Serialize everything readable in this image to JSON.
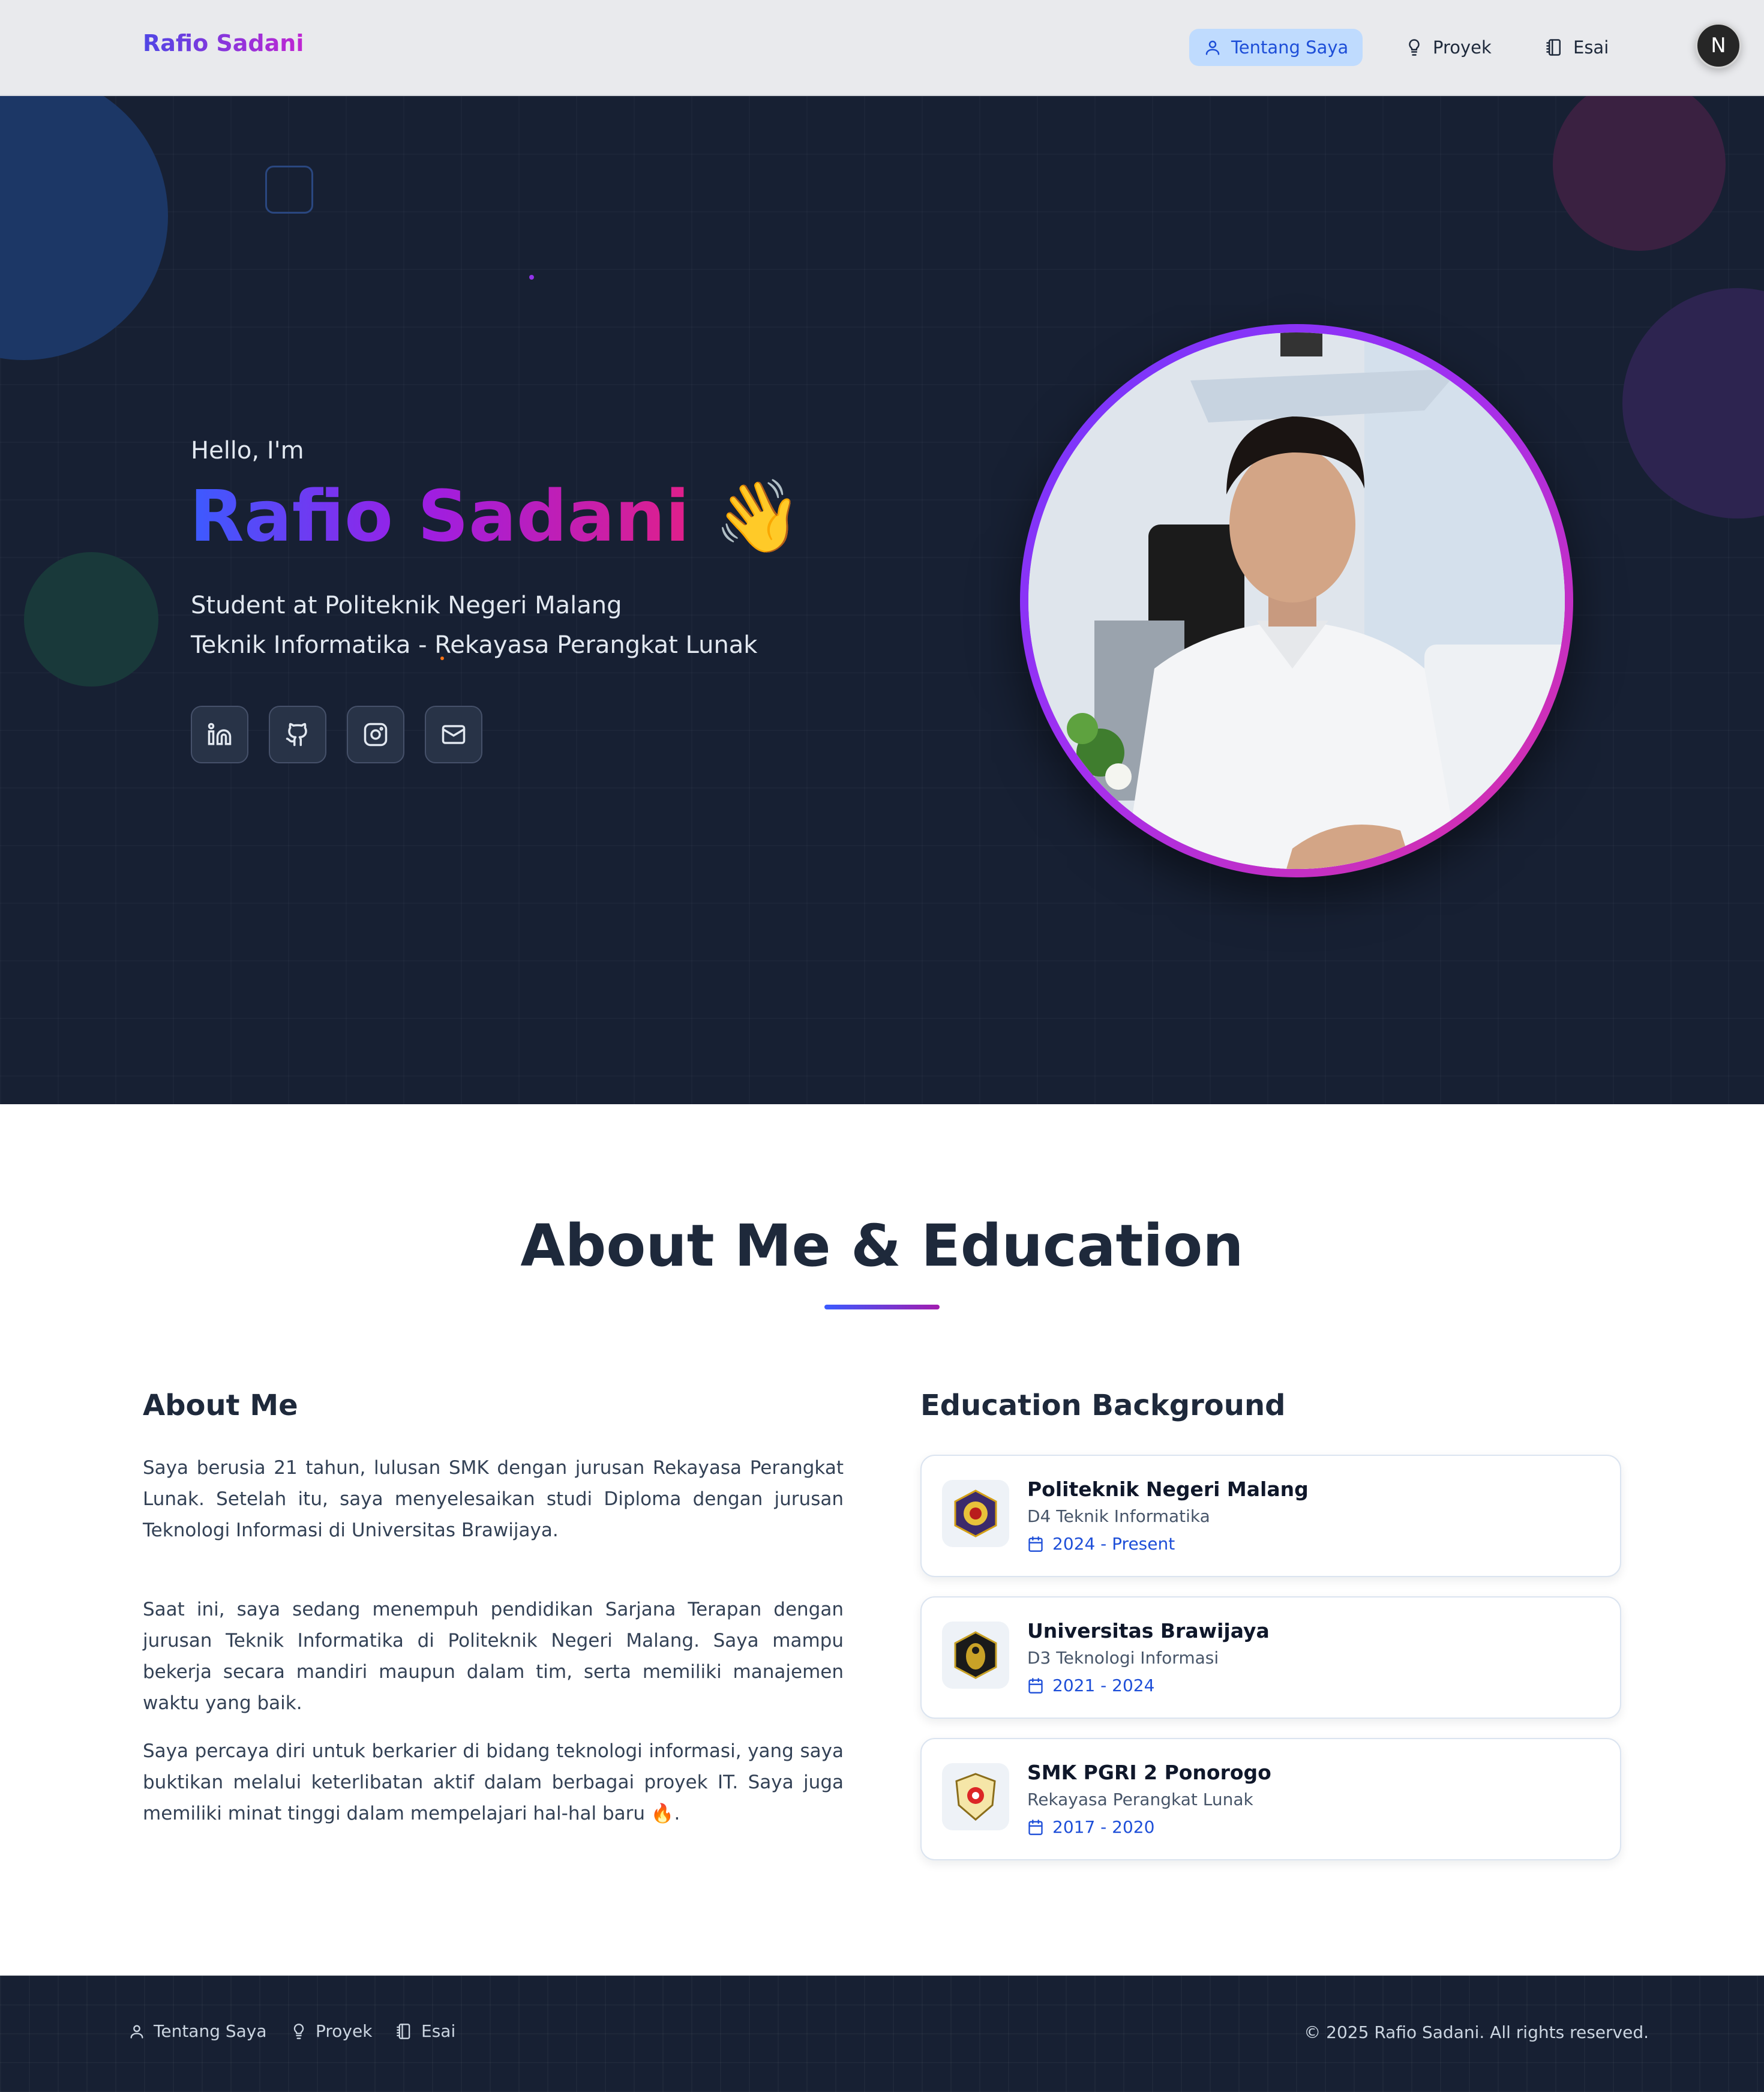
{
  "brand": "Rafio Sadani",
  "nav": {
    "items": [
      {
        "label": "Tentang Saya",
        "icon": "user-icon",
        "active": true
      },
      {
        "label": "Proyek",
        "icon": "lightbulb-icon",
        "active": false
      },
      {
        "label": "Esai",
        "icon": "notebook-icon",
        "active": false
      }
    ],
    "theme_toggle": "N"
  },
  "hero": {
    "greeting": "Hello, I'm",
    "name": "Rafio Sadani",
    "emoji": "👋",
    "subtitle_line1": "Student at Politeknik Negeri Malang",
    "subtitle_line2": "Teknik Informatika - Rekayasa Perangkat Lunak",
    "socials": [
      "linkedin-icon",
      "github-icon",
      "instagram-icon",
      "mail-icon"
    ]
  },
  "about_section": {
    "title": "About Me & Education",
    "about_title": "About Me",
    "paragraphs": [
      "Saya berusia 21 tahun, lulusan SMK dengan jurusan Rekayasa Perangkat Lunak. Setelah itu, saya menyelesaikan studi Diploma dengan jurusan Teknologi Informasi di Universitas Brawijaya.",
      "Saat ini, saya sedang menempuh pendidikan Sarjana Terapan dengan jurusan Teknik Informatika di Politeknik Negeri Malang. Saya mampu bekerja secara mandiri maupun dalam tim, serta memiliki manajemen waktu yang baik.",
      "Saya percaya diri untuk berkarier di bidang teknologi informasi, yang saya buktikan melalui keterlibatan aktif dalam berbagai proyek IT. Saya juga memiliki minat tinggi dalam mempelajari hal-hal baru 🔥."
    ],
    "education_title": "Education Background",
    "education": [
      {
        "school": "Politeknik Negeri Malang",
        "major": "D4 Teknik Informatika",
        "years": "2024 - Present"
      },
      {
        "school": "Universitas Brawijaya",
        "major": "D3 Teknologi Informasi",
        "years": "2021 - 2024"
      },
      {
        "school": "SMK PGRI 2 Ponorogo",
        "major": "Rekayasa Perangkat Lunak",
        "years": "2017 - 2020"
      }
    ]
  },
  "footer": {
    "links": [
      "Tentang Saya",
      "Proyek",
      "Esai"
    ],
    "copyright": "© 2025 Rafio Sadani. All rights reserved."
  },
  "colors": {
    "accent": "#1d4ed8",
    "hero_bg": "#172033",
    "gradient_start": "#3b5bff",
    "gradient_end": "#e01f8a"
  }
}
